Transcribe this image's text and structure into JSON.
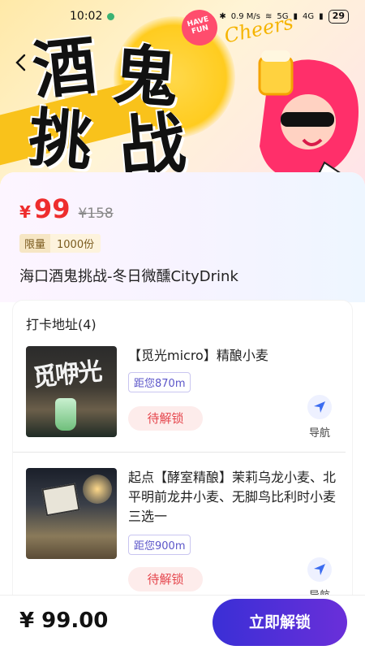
{
  "status_bar": {
    "time": "10:02",
    "net_speed": "0.9 M/s",
    "signal_5g": "5G",
    "signal_4g": "4G",
    "battery": "29"
  },
  "hero": {
    "line1_a": "酒",
    "line1_b": "鬼",
    "line2_a": "挑",
    "line2_b": "战",
    "badge": "HAVE FUN",
    "cheers": "Cheers"
  },
  "offer": {
    "currency": "¥",
    "price": "99",
    "original_price": "¥158",
    "tag_limited": "限量",
    "tag_quantity": "1000份",
    "title": "海口酒鬼挑战-冬日微醺CityDrink"
  },
  "checkin": {
    "header": "打卡地址(4)",
    "items": [
      {
        "name": "【觅光micro】精酿小麦",
        "distance": "距您870m",
        "status": "待解锁",
        "nav_label": "导航",
        "thumb_sign": "觅咿光"
      },
      {
        "name": "起点【酵室精酿】茉莉乌龙小麦、北平明前龙井小麦、无脚鸟比利时小麦三选一",
        "distance": "距您900m",
        "status": "待解锁",
        "nav_label": "导航"
      }
    ]
  },
  "footer": {
    "total": "¥ 99.00",
    "cta": "立即解锁"
  },
  "colors": {
    "price_red": "#ee2d2d",
    "cta_start": "#3a2fd6",
    "cta_end": "#6a2fd9",
    "nav_blue": "#3b6cf0"
  }
}
